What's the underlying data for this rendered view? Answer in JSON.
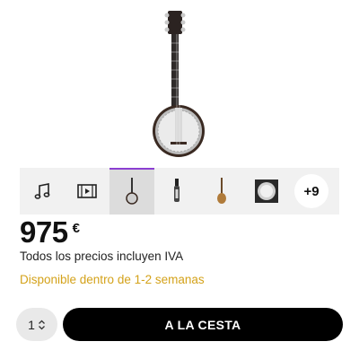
{
  "product": {
    "image": "banjo-product-image",
    "gallery": {
      "thumbnails": [
        {
          "icon": "music-note-icon"
        },
        {
          "icon": "video-icon"
        },
        {
          "icon": "banjo-thumb-1",
          "active": true
        },
        {
          "icon": "banjo-thumb-2"
        },
        {
          "icon": "banjo-thumb-3"
        },
        {
          "icon": "banjo-thumb-4"
        }
      ],
      "more_label": "+9",
      "active_color": "#8b3fd1"
    },
    "price": {
      "amount": "975",
      "currency": "€"
    },
    "tax_note": "Todos los precios incluyen IVA",
    "availability": {
      "text": "Disponible dentro de 1-2 semanas",
      "color": "#d4a21a"
    },
    "quantity": {
      "value": "1"
    },
    "cart_button": {
      "label": "A LA CESTA"
    }
  }
}
